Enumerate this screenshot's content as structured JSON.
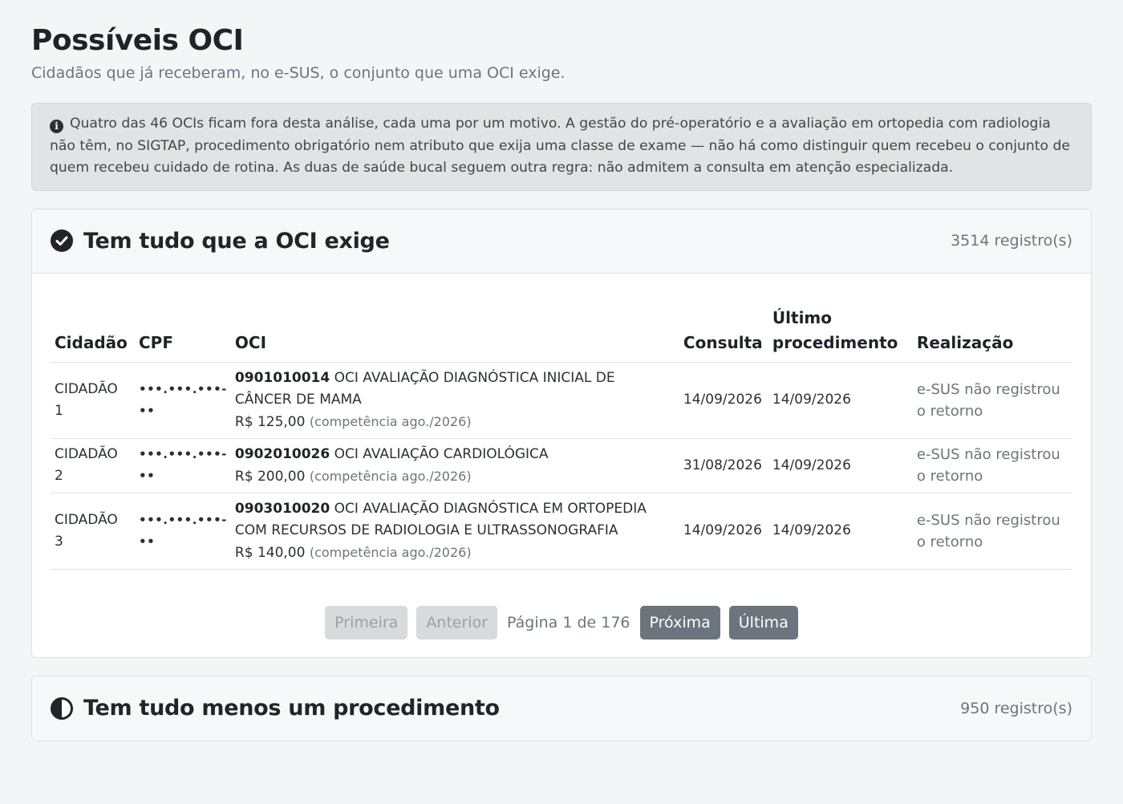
{
  "page": {
    "title": "Possíveis OCI",
    "subtitle": "Cidadãos que já receberam, no e-SUS, o conjunto que uma OCI exige."
  },
  "alert": {
    "icon": "info-icon",
    "text": "Quatro das 46 OCIs ficam fora desta análise, cada uma por um motivo. A gestão do pré-operatório e a avaliação em ortopedia com radiologia não têm, no SIGTAP, procedimento obrigatório nem atributo que exija uma classe de exame — não há como distinguir quem recebeu o conjunto de quem recebeu cuidado de rotina. As duas de saúde bucal seguem outra regra: não admitem a consulta em atenção especializada."
  },
  "section1": {
    "icon": "check-circle-icon",
    "title": "Tem tudo que a OCI exige",
    "count": "3514 registro(s)",
    "headers": {
      "cidadao": "Cidadão",
      "cpf": "CPF",
      "oci": "OCI",
      "consulta": "Consulta",
      "ultimo": "Último procedimento",
      "realizacao": "Realização"
    },
    "rows": [
      {
        "cidadao": "CIDADÃO 1",
        "cpf": "•••.•••.•••-••",
        "oci_code": "0901010014",
        "oci_name": "OCI AVALIAÇÃO DIAGNÓSTICA INICIAL DE CÂNCER DE MAMA",
        "price": "R$ 125,00",
        "competencia": "(competência ago./2026)",
        "consulta": "14/09/2026",
        "ultimo": "14/09/2026",
        "realizacao": "e-SUS não registrou o retorno"
      },
      {
        "cidadao": "CIDADÃO 2",
        "cpf": "•••.•••.•••-••",
        "oci_code": "0902010026",
        "oci_name": "OCI AVALIAÇÃO CARDIOLÓGICA",
        "price": "R$ 200,00",
        "competencia": "(competência ago./2026)",
        "consulta": "31/08/2026",
        "ultimo": "14/09/2026",
        "realizacao": "e-SUS não registrou o retorno"
      },
      {
        "cidadao": "CIDADÃO 3",
        "cpf": "•••.•••.•••-••",
        "oci_code": "0903010020",
        "oci_name": "OCI AVALIAÇÃO DIAGNÓSTICA EM ORTOPEDIA COM RECURSOS DE RADIOLOGIA E ULTRASSONOGRAFIA",
        "price": "R$ 140,00",
        "competencia": "(competência ago./2026)",
        "consulta": "14/09/2026",
        "ultimo": "14/09/2026",
        "realizacao": "e-SUS não registrou o retorno"
      }
    ],
    "pager": {
      "first": "Primeira",
      "prev": "Anterior",
      "info": "Página 1 de 176",
      "next": "Próxima",
      "last": "Última"
    }
  },
  "section2": {
    "icon": "half-circle-icon",
    "title": "Tem tudo menos um procedimento",
    "count": "950 registro(s)"
  },
  "colors": {
    "background": "#f3f5f7",
    "alert_bg": "#e2e3e5",
    "button_active": "#6c757d",
    "button_disabled": "#d8dadc"
  }
}
